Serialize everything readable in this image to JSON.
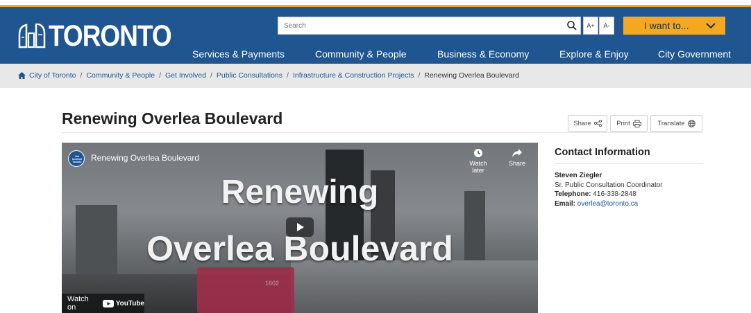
{
  "header": {
    "logo_text": "TORONTO",
    "search": {
      "placeholder": "Search"
    },
    "font_increase": "A+",
    "font_decrease": "A-",
    "i_want_to": "I want to...",
    "nav": [
      {
        "label": "Services & Payments"
      },
      {
        "label": "Community & People"
      },
      {
        "label": "Business & Economy"
      },
      {
        "label": "Explore & Enjoy"
      },
      {
        "label": "City Government"
      }
    ]
  },
  "breadcrumb": [
    "City of Toronto",
    "Community & People",
    "Get Involved",
    "Public Consultations",
    "Infrastructure & Construction Projects",
    "Renewing Overlea Boulevard"
  ],
  "page": {
    "title": "Renewing Overlea Boulevard",
    "tools": {
      "share": "Share",
      "print": "Print",
      "translate": "Translate"
    }
  },
  "video": {
    "channel_name": "Renewing Overlea Boulevard",
    "channel_logo_text": "Get Involved Toronto",
    "headline_line1": "Renewing",
    "headline_line2": "Overlea Boulevard",
    "watch_later": "Watch later",
    "share": "Share",
    "watch_on": "Watch on",
    "youtube": "YouTube",
    "bus_number": "1602"
  },
  "contact": {
    "heading": "Contact Information",
    "name": "Steven Ziegler",
    "role": "Sr. Public Consultation Coordinator",
    "telephone_label": "Telephone:",
    "telephone": "416-338-2848",
    "email_label": "Email:",
    "email": "overlea@toronto.ca"
  },
  "colors": {
    "header_blue": "#1f5591",
    "accent_orange": "#f4a81d",
    "link_blue": "#1f5591",
    "breadcrumb_bg": "#e8e8e8"
  }
}
